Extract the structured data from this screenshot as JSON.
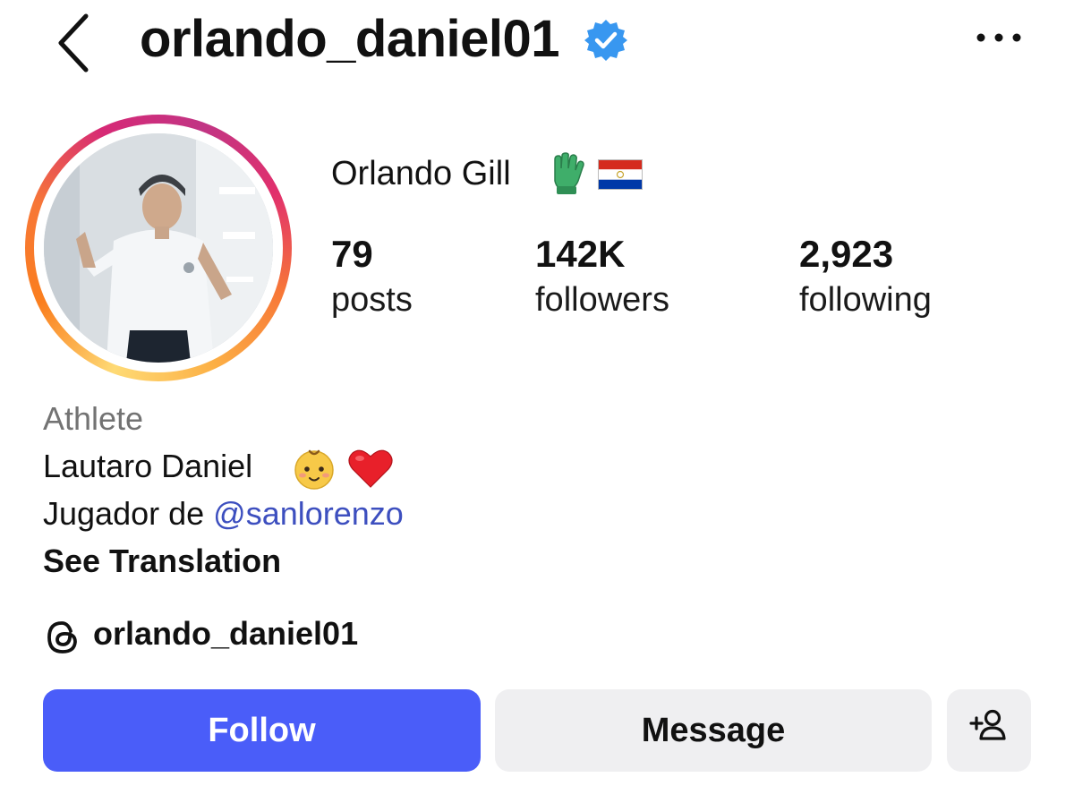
{
  "header": {
    "username": "orlando_daniel01",
    "verified": true
  },
  "profile": {
    "full_name": "Orlando Gill",
    "name_emojis": [
      "goalkeeper-glove",
      "paraguay-flag"
    ],
    "stats": {
      "posts": {
        "value": "79",
        "label": "posts"
      },
      "followers": {
        "value": "142K",
        "label": "followers"
      },
      "following": {
        "value": "2,923",
        "label": "following"
      }
    }
  },
  "bio": {
    "category": "Athlete",
    "line1": "Lautaro Daniel",
    "line1_emojis": [
      "baby",
      "red-heart"
    ],
    "line2_prefix": "Jugador de ",
    "line2_mention": "@sanlorenzo",
    "see_translation": "See Translation",
    "threads_handle": "orlando_daniel01"
  },
  "actions": {
    "follow": "Follow",
    "message": "Message"
  },
  "colors": {
    "follow_button": "#4a5df9",
    "secondary_button": "#efeff1",
    "verified_badge": "#3897f0",
    "mention": "#3d4fbf",
    "category_text": "#737373"
  }
}
